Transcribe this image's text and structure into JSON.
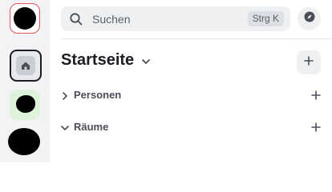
{
  "rail": {
    "items": [
      {
        "name": "user-avatar",
        "icon": "avatar"
      },
      {
        "name": "home",
        "icon": "home-icon"
      },
      {
        "name": "space-1",
        "icon": "avatar"
      },
      {
        "name": "space-2",
        "icon": "avatar"
      }
    ]
  },
  "search": {
    "label": "Suchen",
    "shortcut": "Strg K"
  },
  "header": {
    "title": "Startseite"
  },
  "sections": [
    {
      "label": "Personen",
      "expanded": false
    },
    {
      "label": "Räume",
      "expanded": true
    }
  ],
  "colors": {
    "accent_border": "#e05252",
    "green_space": "#dff3dc"
  }
}
